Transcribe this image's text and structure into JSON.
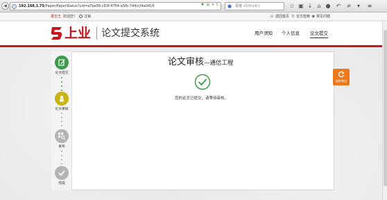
{
  "browser": {
    "url_host": "192.168.1.75",
    "url_path": "/Paper/PaperStatus?uid=a7ba56-c63f-4754-a5fb-744ccf4a0416",
    "search_placeholder": "百度 <Ctrl+K>",
    "search_engine_icon": "baidu-icon"
  },
  "topbar": {
    "user_name": "董亚玉",
    "welcome": "欢迎您！",
    "logout": "注销",
    "links": [
      "返回首页",
      "论文检索",
      "常见问题"
    ]
  },
  "header": {
    "logo_text": "上业",
    "system_title": "论文提交系统",
    "nav": [
      "用户须知",
      "个人信息",
      "论文提交"
    ],
    "active_nav": "论文提交",
    "brand_color": "#c8161d"
  },
  "steps": [
    {
      "label": "论文提交",
      "state": "done",
      "color": "#3f9a4c",
      "icon": "edit-icon"
    },
    {
      "label": "论文审核",
      "state": "current",
      "color": "#c9b312",
      "icon": "user-lock-icon"
    },
    {
      "label": "发布",
      "state": "pending",
      "color": "#b4b4b4",
      "icon": "grid-search-icon"
    },
    {
      "label": "完成",
      "state": "pending",
      "color": "#b4b4b4",
      "icon": "check-icon"
    }
  ],
  "main": {
    "title": "论文审核",
    "subtitle": "—通信工程",
    "status_message": "您的论文已提交，请等待审核。",
    "status_icon": "check-circle-icon",
    "status_color": "#3f9a4c"
  },
  "side_button": {
    "label": "选择单位",
    "icon": "refresh-icon",
    "color": "#ec7a1c"
  }
}
